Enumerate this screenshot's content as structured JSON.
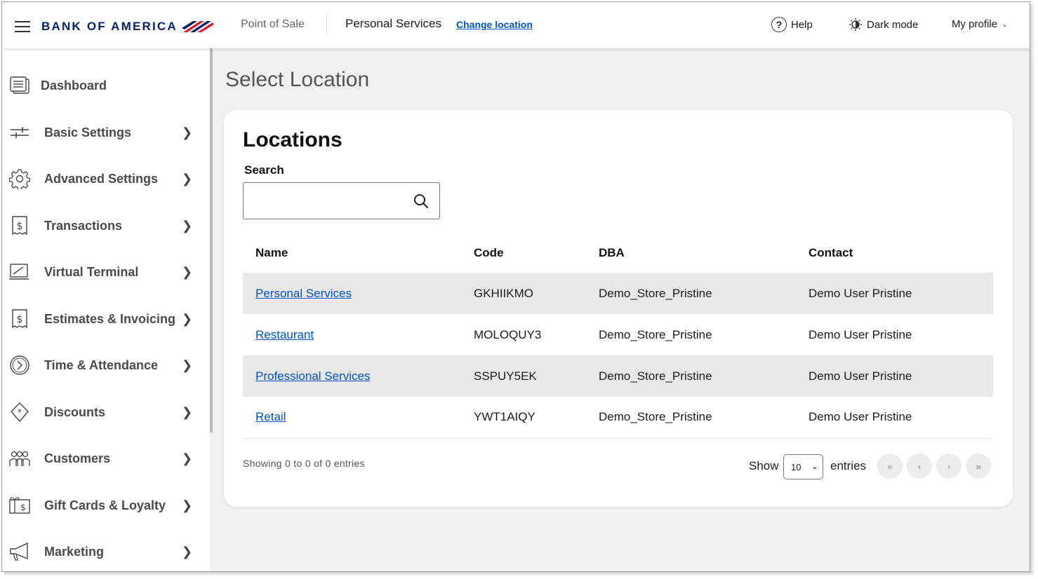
{
  "header": {
    "brand": "BANK OF AMERICA",
    "app_name": "Point of Sale",
    "location": "Personal Services",
    "change_location": "Change location",
    "help": "Help",
    "dark_mode": "Dark mode",
    "my_profile": "My profile",
    "brand_colors": {
      "navy": "#012169",
      "red": "#e31837"
    }
  },
  "sidebar": {
    "items": [
      {
        "label": "Dashboard",
        "icon": "dashboard-icon"
      },
      {
        "label": "Basic Settings",
        "icon": "sliders-icon"
      },
      {
        "label": "Advanced Settings",
        "icon": "gear-icon"
      },
      {
        "label": "Transactions",
        "icon": "receipt-dollar-icon"
      },
      {
        "label": "Virtual Terminal",
        "icon": "terminal-icon"
      },
      {
        "label": "Estimates & Invoicing",
        "icon": "invoice-dollar-icon"
      },
      {
        "label": "Time & Attendance",
        "icon": "clock-icon"
      },
      {
        "label": "Discounts",
        "icon": "discount-tag-icon"
      },
      {
        "label": "Customers",
        "icon": "customers-icon"
      },
      {
        "label": "Gift Cards & Loyalty",
        "icon": "gift-card-icon"
      },
      {
        "label": "Marketing",
        "icon": "megaphone-icon"
      }
    ]
  },
  "main": {
    "page_title": "Select Location",
    "card_title": "Locations",
    "search": {
      "label": "Search",
      "value": ""
    },
    "table": {
      "columns": [
        "Name",
        "Code",
        "DBA",
        "Contact"
      ],
      "rows": [
        {
          "name": "Personal Services",
          "code": "GKHIIKMO",
          "dba": "Demo_Store_Pristine",
          "contact": "Demo User Pristine"
        },
        {
          "name": "Restaurant",
          "code": "MOLOQUY3",
          "dba": "Demo_Store_Pristine",
          "contact": "Demo User Pristine"
        },
        {
          "name": "Professional Services",
          "code": "SSPUY5EK",
          "dba": "Demo_Store_Pristine",
          "contact": "Demo User Pristine"
        },
        {
          "name": "Retail",
          "code": "YWT1AIQY",
          "dba": "Demo_Store_Pristine",
          "contact": "Demo User Pristine"
        }
      ]
    },
    "footer": {
      "showing": "Showing 0 to 0 of 0 entries",
      "show": "Show",
      "entries_value": "10",
      "entries": "entries",
      "pagination": [
        "«",
        "‹",
        "›",
        "»"
      ]
    }
  }
}
